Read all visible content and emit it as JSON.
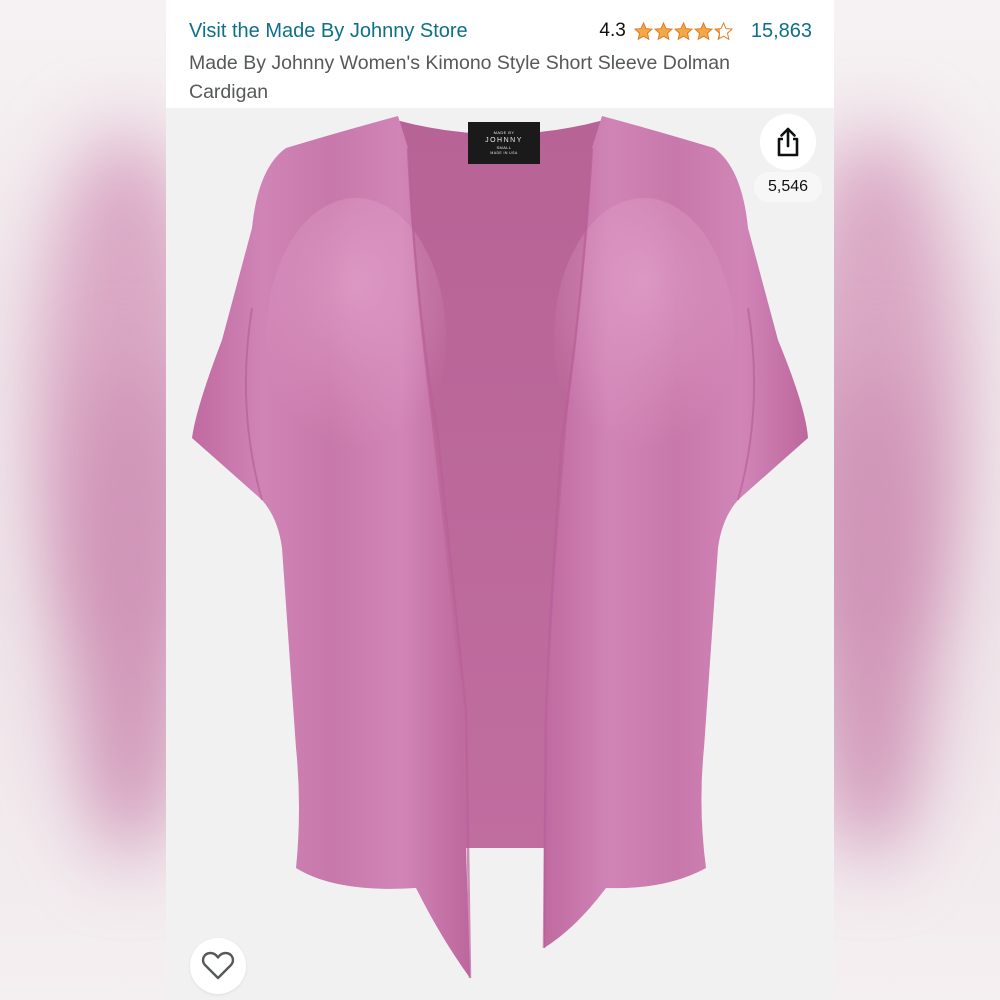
{
  "header": {
    "store_link": "Visit the Made By Johnny Store",
    "rating": "4.3",
    "review_count": "15,863",
    "product_title": "Made By Johnny Women's Kimono Style Short Sleeve Dolman Cardigan"
  },
  "rating_stars": {
    "value": 4.3,
    "max": 5,
    "color": "#f3a847"
  },
  "product_image": {
    "label_lines": [
      "MADE BY",
      "JOHNNY",
      "SMALL",
      "MADE IN USA"
    ],
    "garment_color": "#c876a8"
  },
  "actions": {
    "share_count": "5,546",
    "share_icon": "share-icon",
    "favorite_icon": "heart-outline-icon"
  },
  "colors": {
    "link": "#0e6f8a",
    "title": "#565959"
  }
}
